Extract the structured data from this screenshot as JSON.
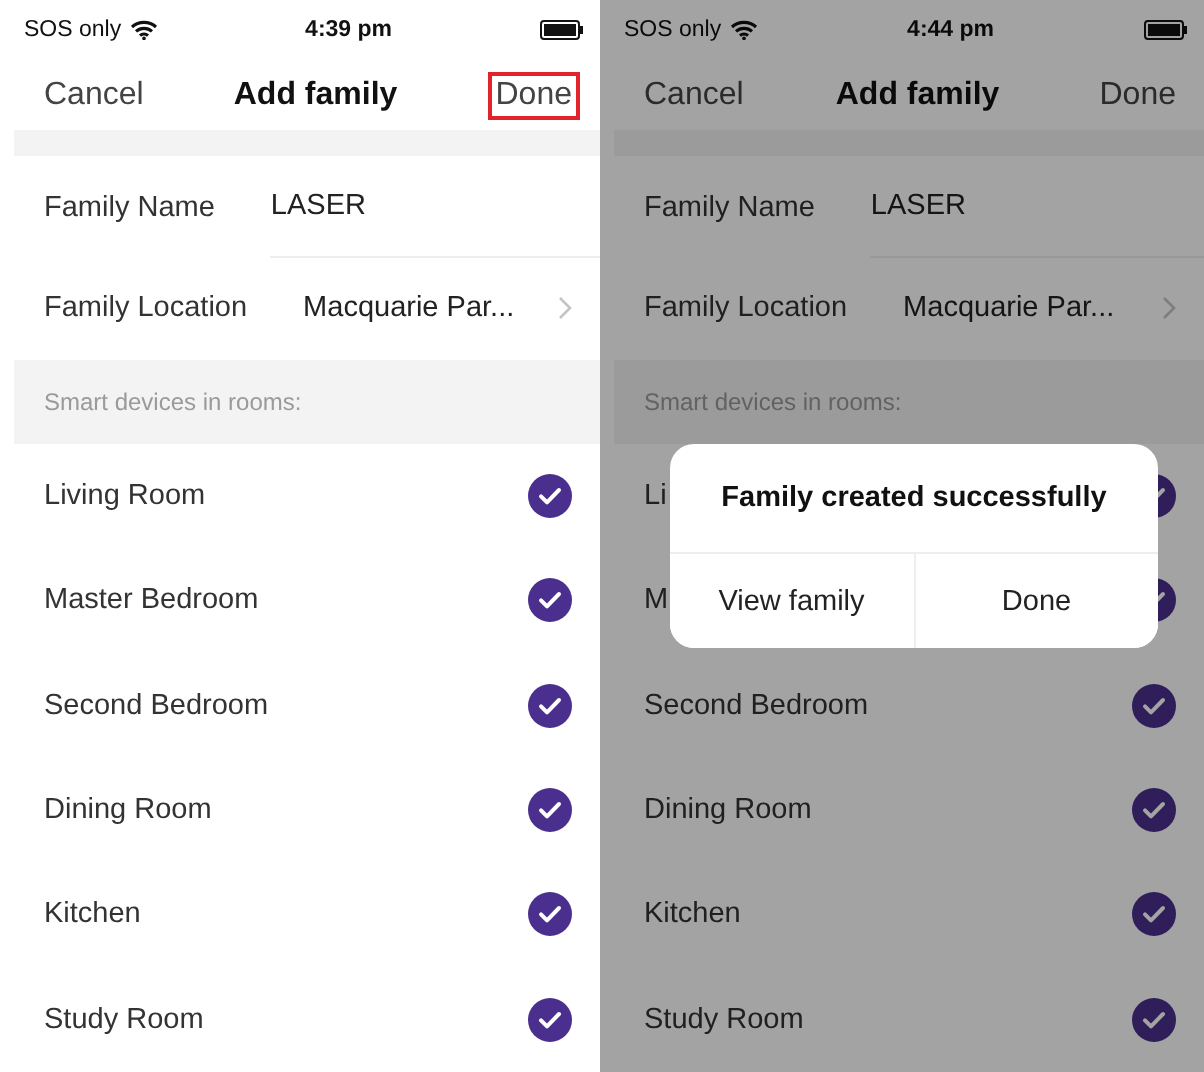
{
  "screens": [
    {
      "status_bar": {
        "carrier": "SOS only",
        "time": "4:39 pm"
      },
      "nav": {
        "cancel": "Cancel",
        "title": "Add family",
        "done": "Done",
        "done_highlighted": true
      },
      "fields": [
        {
          "kind": "text",
          "label": "Family Name",
          "value": "LASER"
        },
        {
          "kind": "link",
          "label": "Family Location",
          "value": "Macquarie Par..."
        }
      ],
      "section_header": "Smart devices in rooms:",
      "rooms": [
        {
          "name": "Living Room",
          "checked": true
        },
        {
          "name": "Master Bedroom",
          "checked": true
        },
        {
          "name": "Second Bedroom",
          "checked": true
        },
        {
          "name": "Dining Room",
          "checked": true
        },
        {
          "name": "Kitchen",
          "checked": true
        },
        {
          "name": "Study Room",
          "checked": true
        }
      ],
      "dimmed": false
    },
    {
      "status_bar": {
        "carrier": "SOS only",
        "time": "4:44 pm"
      },
      "nav": {
        "cancel": "Cancel",
        "title": "Add family",
        "done": "Done",
        "done_highlighted": false
      },
      "fields": [
        {
          "kind": "text",
          "label": "Family Name",
          "value": "LASER"
        },
        {
          "kind": "link",
          "label": "Family Location",
          "value": "Macquarie Par..."
        }
      ],
      "section_header": "Smart devices in rooms:",
      "rooms": [
        {
          "name": "Li",
          "checked": true
        },
        {
          "name": "M",
          "checked": true
        },
        {
          "name": "Second Bedroom",
          "checked": true
        },
        {
          "name": "Dining Room",
          "checked": true
        },
        {
          "name": "Kitchen",
          "checked": true
        },
        {
          "name": "Study Room",
          "checked": true
        }
      ],
      "dimmed": true,
      "dialog": {
        "message": "Family created successfully",
        "buttons": [
          "View family",
          "Done"
        ]
      }
    }
  ]
}
